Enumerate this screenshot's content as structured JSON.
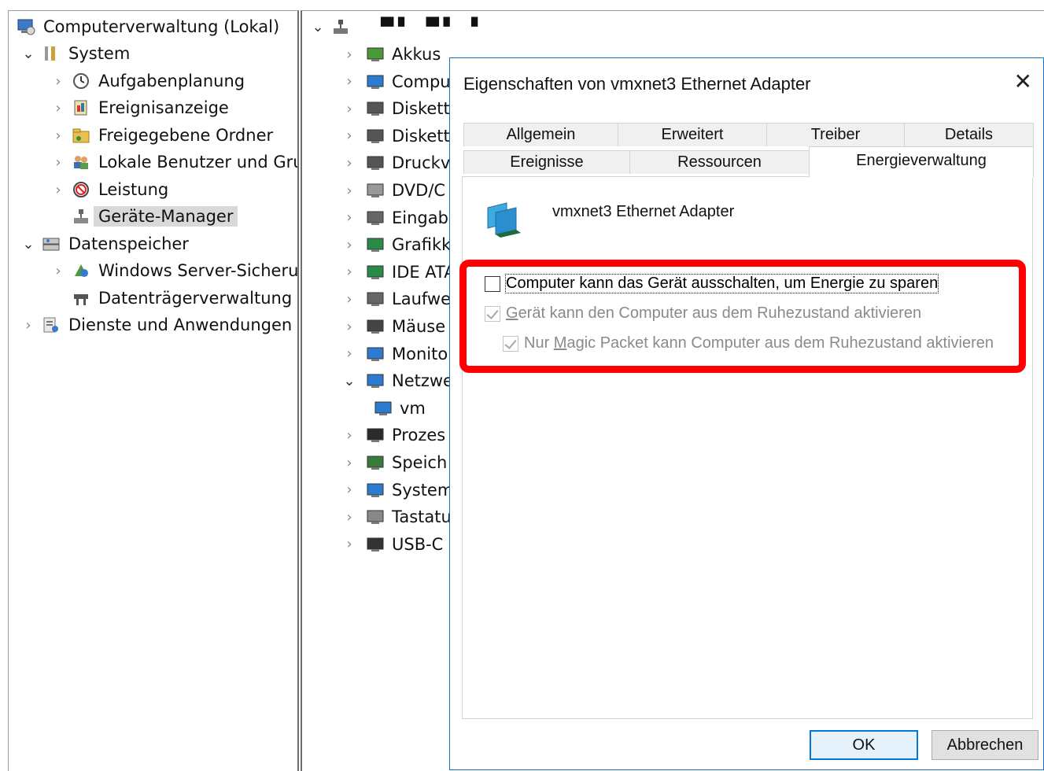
{
  "console_tree": {
    "items": [
      {
        "label": "Computerverwaltung (Lokal)",
        "icon": "computer-management-icon"
      },
      {
        "label": "System",
        "icon": "system-tools-icon"
      },
      {
        "label": "Aufgabenplanung",
        "icon": "clock-icon"
      },
      {
        "label": "Ereignisanzeige",
        "icon": "event-viewer-icon"
      },
      {
        "label": "Freigegebene Ordner",
        "icon": "shared-folder-icon"
      },
      {
        "label": "Lokale Benutzer und Gru",
        "icon": "users-icon"
      },
      {
        "label": "Leistung",
        "icon": "performance-icon"
      },
      {
        "label": "Geräte-Manager",
        "icon": "device-manager-icon"
      },
      {
        "label": "Datenspeicher",
        "icon": "storage-icon"
      },
      {
        "label": "Windows Server-Sicheru",
        "icon": "backup-icon"
      },
      {
        "label": "Datenträgerverwaltung",
        "icon": "disk-management-icon"
      },
      {
        "label": "Dienste und Anwendungen",
        "icon": "services-icon"
      }
    ]
  },
  "device_tree": {
    "root_label": "▀▘ ▀▘ ▘",
    "items": [
      {
        "label": "Akkus",
        "icon": "battery-icon"
      },
      {
        "label": "Compu",
        "icon": "monitor-icon"
      },
      {
        "label": "Diskett",
        "icon": "floppy-controller-icon"
      },
      {
        "label": "Diskett",
        "icon": "floppy-drive-icon"
      },
      {
        "label": "Druckv",
        "icon": "printer-icon"
      },
      {
        "label": "DVD/C",
        "icon": "dvd-icon"
      },
      {
        "label": "Eingab",
        "icon": "keyboard-input-icon"
      },
      {
        "label": "Grafikk",
        "icon": "display-adapter-icon"
      },
      {
        "label": "IDE ATA",
        "icon": "ide-icon"
      },
      {
        "label": "Laufwe",
        "icon": "drive-icon"
      },
      {
        "label": "Mäuse",
        "icon": "mouse-icon"
      },
      {
        "label": "Monito",
        "icon": "monitor-icon"
      },
      {
        "label": "Netzwe",
        "icon": "network-icon"
      },
      {
        "label": "vm",
        "icon": "network-adapter-icon"
      },
      {
        "label": "Prozes",
        "icon": "processor-icon"
      },
      {
        "label": "Speich",
        "icon": "memory-icon"
      },
      {
        "label": "System",
        "icon": "system-device-icon"
      },
      {
        "label": "Tastatu",
        "icon": "keyboard-icon"
      },
      {
        "label": "USB-C",
        "icon": "usb-icon"
      }
    ]
  },
  "dialog": {
    "title": "Eigenschaften von vmxnet3 Ethernet Adapter",
    "close_glyph": "✕",
    "tabs_row1": [
      "Allgemein",
      "Erweitert",
      "Treiber",
      "Details"
    ],
    "tabs_row2": [
      "Ereignisse",
      "Ressourcen",
      "Energieverwaltung"
    ],
    "active_tab": "Energieverwaltung",
    "device_name": "vmxnet3 Ethernet Adapter",
    "options": [
      {
        "label": "Computer kann das Gerät ausschalten, um Energie zu sparen",
        "checked": false,
        "enabled": true
      },
      {
        "label_pre": "",
        "label_accel": "G",
        "label_post": "erät kann den Computer aus dem Ruhezustand aktivieren",
        "checked": true,
        "enabled": false
      },
      {
        "label_pre": "Nur ",
        "label_accel": "M",
        "label_post": "agic Packet kann Computer aus dem Ruhezustand aktivieren",
        "checked": true,
        "enabled": false
      }
    ],
    "ok_label": "OK",
    "cancel_label": "Abbrechen"
  },
  "colors": {
    "highlight": "#ff0000",
    "accent": "#0078d7"
  }
}
